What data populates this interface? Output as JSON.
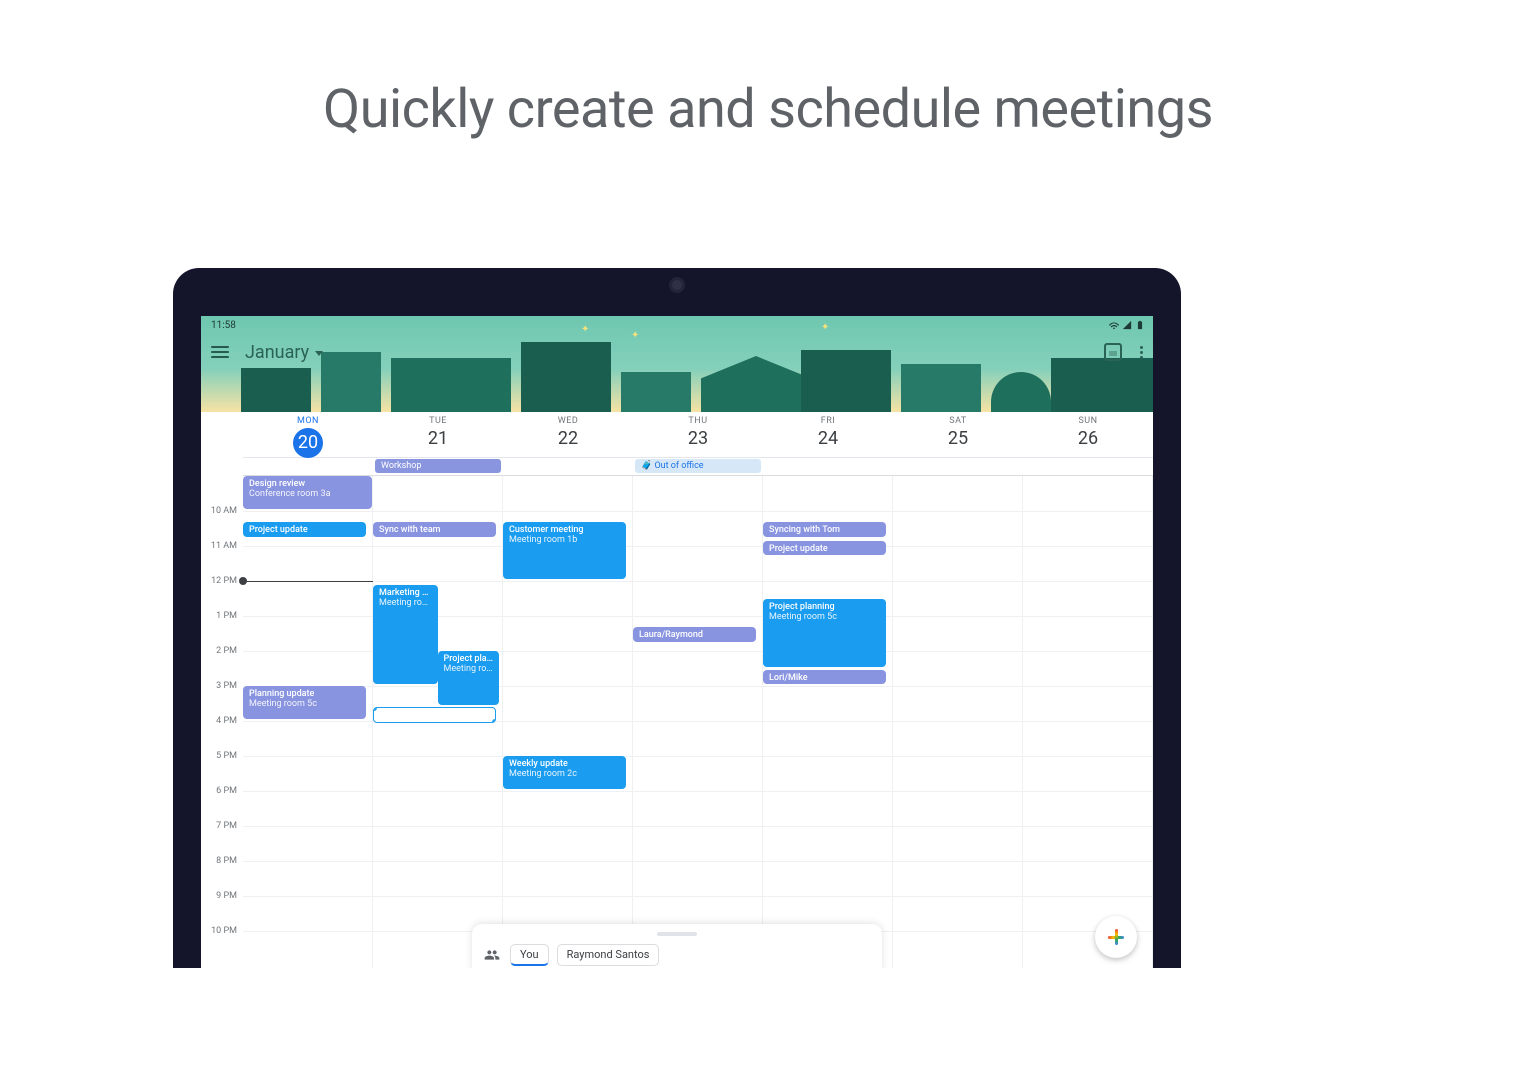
{
  "marketing_headline": "Quickly create and schedule meetings",
  "status": {
    "time": "11:58"
  },
  "header": {
    "month": "January"
  },
  "grid": {
    "startHour": 9,
    "endHour": 22,
    "hourPx": 35,
    "nowHour": 12.0
  },
  "days": [
    {
      "abbr": "MON",
      "num": "20",
      "today": true
    },
    {
      "abbr": "TUE",
      "num": "21",
      "today": false
    },
    {
      "abbr": "WED",
      "num": "22",
      "today": false
    },
    {
      "abbr": "THU",
      "num": "23",
      "today": false
    },
    {
      "abbr": "FRI",
      "num": "24",
      "today": false
    },
    {
      "abbr": "SAT",
      "num": "25",
      "today": false
    },
    {
      "abbr": "SUN",
      "num": "26",
      "today": false
    }
  ],
  "hours": [
    "10 AM",
    "11 AM",
    "12 PM",
    "1 PM",
    "2 PM",
    "3 PM",
    "4 PM",
    "5 PM",
    "6 PM",
    "7 PM",
    "8 PM",
    "9 PM",
    "10 PM"
  ],
  "alldayEvents": [
    {
      "day": 1,
      "span": 1,
      "title": "Workshop",
      "color": "ev-viodk"
    },
    {
      "day": 3,
      "span": 1,
      "title": "Out of office",
      "color": "ooo",
      "icon": "briefcase"
    }
  ],
  "events": [
    {
      "day": 0,
      "start": 9.0,
      "end": 10.0,
      "title": "Design review",
      "sub": "Conference room 3a",
      "color": "ev-violet",
      "left": 0,
      "width": 1
    },
    {
      "day": 0,
      "start": 10.3,
      "end": 10.8,
      "title": "Project update",
      "sub": "",
      "color": "ev-blue",
      "left": 0,
      "width": 0.95
    },
    {
      "day": 0,
      "start": 15.0,
      "end": 16.0,
      "title": "Planning update",
      "sub": "Meeting room 5c",
      "color": "ev-violet",
      "left": 0,
      "width": 0.95
    },
    {
      "day": 1,
      "start": 10.3,
      "end": 10.8,
      "title": "Sync with team",
      "sub": "",
      "color": "ev-violet",
      "left": 0,
      "width": 0.95
    },
    {
      "day": 1,
      "start": 12.1,
      "end": 15.0,
      "title": "Marketing workshop",
      "sub": "Meeting room",
      "color": "ev-blue",
      "left": 0,
      "width": 0.5
    },
    {
      "day": 1,
      "start": 14.0,
      "end": 15.6,
      "title": "Project planning",
      "sub": "Meeting room",
      "color": "ev-blue",
      "left": 0.5,
      "width": 0.48
    },
    {
      "day": 1,
      "start": 15.6,
      "end": 16.1,
      "title": "",
      "sub": "",
      "color": "empty-sel",
      "left": 0,
      "width": 0.95,
      "selection": true
    },
    {
      "day": 2,
      "start": 10.3,
      "end": 12.0,
      "title": "Customer meeting",
      "sub": "Meeting room 1b",
      "color": "ev-blue",
      "left": 0,
      "width": 0.95
    },
    {
      "day": 2,
      "start": 17.0,
      "end": 18.0,
      "title": "Weekly update",
      "sub": "Meeting room 2c",
      "color": "ev-blue",
      "left": 0,
      "width": 0.95
    },
    {
      "day": 3,
      "start": 13.3,
      "end": 13.8,
      "title": "Laura/Raymond",
      "sub": "",
      "color": "ev-violet",
      "left": 0,
      "width": 0.95
    },
    {
      "day": 4,
      "start": 10.3,
      "end": 10.8,
      "title": "Syncing with Tom",
      "sub": "",
      "color": "ev-violet",
      "left": 0,
      "width": 0.95
    },
    {
      "day": 4,
      "start": 10.85,
      "end": 11.3,
      "title": "Project update",
      "sub": "",
      "color": "ev-violet",
      "left": 0,
      "width": 0.95
    },
    {
      "day": 4,
      "start": 12.5,
      "end": 14.5,
      "title": "Project planning",
      "sub": "Meeting room 5c",
      "color": "ev-blue",
      "left": 0,
      "width": 0.95
    },
    {
      "day": 4,
      "start": 14.55,
      "end": 15.0,
      "title": "Lori/Mike",
      "sub": "",
      "color": "ev-violet",
      "left": 0,
      "width": 0.95
    }
  ],
  "sheet": {
    "chips": [
      {
        "label": "You",
        "active": true
      },
      {
        "label": "Raymond Santos",
        "active": false
      }
    ]
  }
}
